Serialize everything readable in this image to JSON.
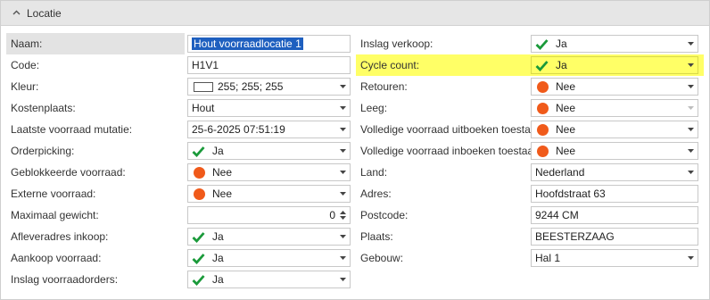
{
  "panel": {
    "title": "Locatie"
  },
  "left": {
    "naam": {
      "label": "Naam:",
      "value": "Hout voorraadlocatie 1"
    },
    "code": {
      "label": "Code:",
      "value": "H1V1"
    },
    "kleur": {
      "label": "Kleur:",
      "value": "255; 255; 255"
    },
    "kostenplaats": {
      "label": "Kostenplaats:",
      "value": "Hout"
    },
    "laatste": {
      "label": "Laatste voorraad mutatie:",
      "value": "25-6-2025 07:51:19"
    },
    "orderpicking": {
      "label": "Orderpicking:",
      "value": "Ja"
    },
    "geblokkeerde": {
      "label": "Geblokkeerde voorraad:",
      "value": "Nee"
    },
    "externe": {
      "label": "Externe voorraad:",
      "value": "Nee"
    },
    "maximaal": {
      "label": "Maximaal gewicht:",
      "value": "0"
    },
    "afleveradres": {
      "label": "Afleveradres inkoop:",
      "value": "Ja"
    },
    "aankoop": {
      "label": "Aankoop voorraad:",
      "value": "Ja"
    },
    "inslagorders": {
      "label": "Inslag voorraadorders:",
      "value": "Ja"
    }
  },
  "right": {
    "inslag": {
      "label": "Inslag verkoop:",
      "value": "Ja"
    },
    "cycle": {
      "label": "Cycle count:",
      "value": "Ja"
    },
    "retouren": {
      "label": "Retouren:",
      "value": "Nee"
    },
    "leeg": {
      "label": "Leeg:",
      "value": "Nee"
    },
    "uitboeken": {
      "label": "Volledige voorraad uitboeken toestaan:",
      "value": "Nee"
    },
    "inboeken": {
      "label": "Volledige voorraad inboeken toestaan:",
      "value": "Nee"
    },
    "land": {
      "label": "Land:",
      "value": "Nederland"
    },
    "adres": {
      "label": "Adres:",
      "value": "Hoofdstraat 63"
    },
    "postcode": {
      "label": "Postcode:",
      "value": "9244 CM"
    },
    "plaats": {
      "label": "Plaats:",
      "value": "BEESTERZAAG"
    },
    "gebouw": {
      "label": "Gebouw:",
      "value": "Hal 1"
    }
  },
  "colors": {
    "highlight": "#ffff66",
    "check": "#1a9a3a",
    "dot": "#f05a1a",
    "selection": "#1e5fbf"
  }
}
